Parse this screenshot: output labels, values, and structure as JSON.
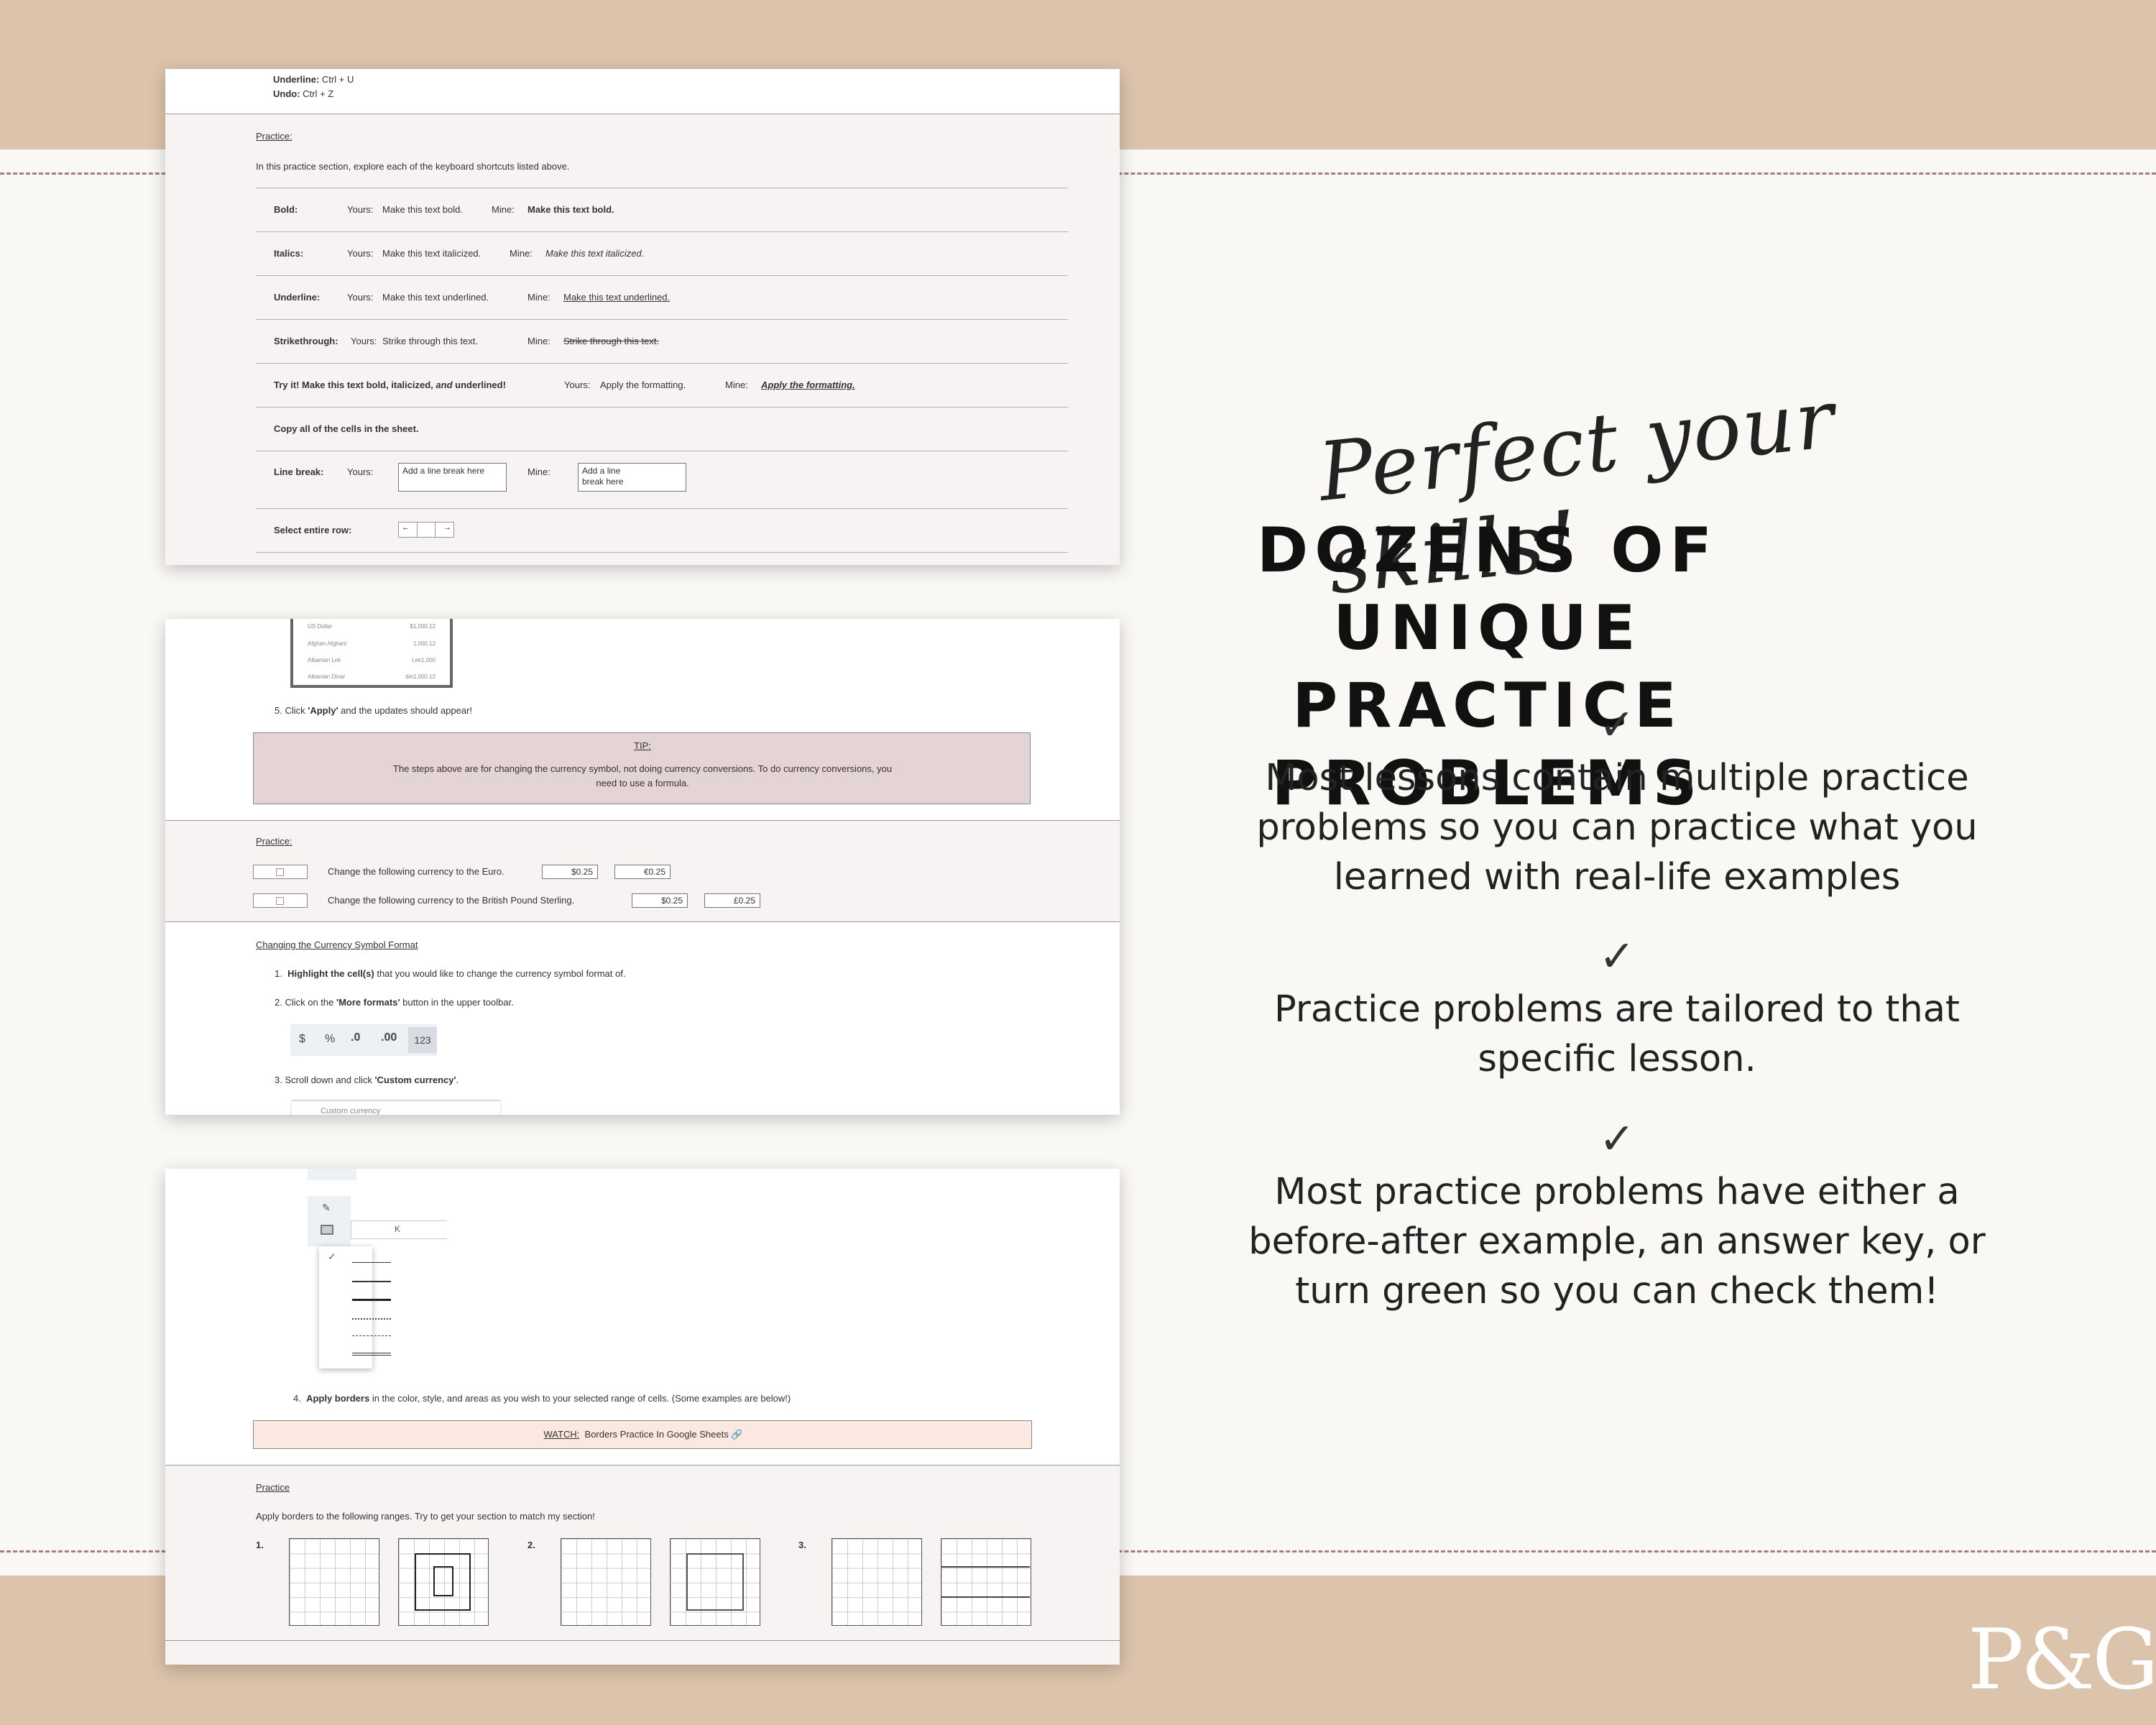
{
  "card1": {
    "underline_line_label": "Underline:",
    "underline_line_value": "Ctrl + U",
    "undo_label": "Undo:",
    "undo_value": "Ctrl + Z",
    "practice_heading": "Practice:",
    "intro": "In this practice section, explore each of the keyboard shortcuts listed above.",
    "rows": [
      {
        "label": "Bold:",
        "yours_label": "Yours:",
        "yours": "Make this text bold.",
        "mine_label": "Mine:",
        "mine": "Make this text bold."
      },
      {
        "label": "Italics:",
        "yours_label": "Yours:",
        "yours": "Make this text italicized.",
        "mine_label": "Mine:",
        "mine": "Make this text italicized."
      },
      {
        "label": "Underline:",
        "yours_label": "Yours:",
        "yours": "Make this text underlined.",
        "mine_label": "Mine:",
        "mine": "Make this text underlined."
      },
      {
        "label": "Strikethrough:",
        "yours_label": "Yours:",
        "yours": "Strike through this text.",
        "mine_label": "Mine:",
        "mine": "Strike through this text."
      }
    ],
    "tryit_a": "Try it! Make this text bold, italicized,",
    "tryit_and": "and",
    "tryit_b": "underlined!",
    "tryit_yours_label": "Yours:",
    "tryit_yours": "Apply the formatting.",
    "tryit_mine_label": "Mine:",
    "tryit_mine": "Apply the formatting.",
    "copy_all": "Copy all of the cells in the sheet.",
    "linebreak_label": "Line break:",
    "linebreak_yours_label": "Yours:",
    "linebreak_yours": "Add a line break here",
    "linebreak_mine_label": "Mine:",
    "linebreak_mine_1": "Add a line",
    "linebreak_mine_2": "break here",
    "select_row_label": "Select entire row:",
    "arrow_left": "←",
    "arrow_right": "→"
  },
  "card2": {
    "currency_rows": [
      {
        "name": "US Dollar",
        "value": "$1,000.12"
      },
      {
        "name": "Afghan Afghani",
        "value": "1,000.12"
      },
      {
        "name": "Albanian Lek",
        "value": "Lek1,000"
      },
      {
        "name": "Albanian Dinar",
        "value": "din1,000.12"
      }
    ],
    "step5_pre": "5.  Click",
    "step5_bold": "'Apply'",
    "step5_post": "and the updates should appear!",
    "tip_heading": "TIP:",
    "tip_text_1": "The steps above are for changing the currency symbol, not doing currency conversions. To do currency conversions, you",
    "tip_text_2": "need to use a formula.",
    "practice_heading": "Practice:",
    "practice_rows": [
      {
        "text": "Change the following currency to the Euro.",
        "from": "$0.25",
        "to": "€0.25"
      },
      {
        "text": "Change the following currency to the British Pound Sterling.",
        "from": "$0.25",
        "to": "£0.25"
      }
    ],
    "changing_heading": "Changing the Currency Symbol Format",
    "step1_num": "1.",
    "step1_bold": "Highlight the cell(s)",
    "step1_post": "that you would like to change the currency symbol format of.",
    "step2_pre": "2.  Click on the",
    "step2_bold": "'More formats'",
    "step2_post": "button in the upper toolbar.",
    "toolbar": [
      "$",
      "%",
      ".0",
      ".00",
      "123"
    ],
    "step3_pre": "3.  Scroll down and click",
    "step3_bold": "'Custom currency'",
    "step3_post": ".",
    "cut_text": "Custom currency"
  },
  "card3": {
    "dots": "•••••",
    "column_label": "K",
    "check": "✓",
    "step4_num": "4.",
    "step4_bold": "Apply borders",
    "step4_post": "in the color, style, and areas as you wish to your selected range of cells. (Some examples are below!)",
    "watch_label": "WATCH:",
    "watch_text": "Borders Practice In Google Sheets",
    "link_icon": "🔗",
    "practice_heading": "Practice",
    "practice_intro": "Apply borders to the following ranges. Try to get your section to match my section!",
    "nums": [
      "1.",
      "2.",
      "3."
    ]
  },
  "right": {
    "script_text": "Perfect your skills!",
    "headline_1": "DOZENS OF UNIQUE",
    "headline_2": "PRACTICE PROBLEMS",
    "check": "✓",
    "point1_l1": "Most lessons contain multiple practice",
    "point1_l2": "problems so you can practice what you",
    "point1_l3": "learned with real-life examples",
    "point2_l1": "Practice problems are tailored to that",
    "point2_l2": "specific lesson.",
    "point3_l1": "Most practice problems have either a",
    "point3_l2": "before-after example, an answer key, or",
    "point3_l3": "turn green so you can check them!"
  },
  "brand": {
    "logo": "P&G"
  },
  "colors": {
    "band": "#dcc3ac",
    "background": "#faf8f5",
    "dash": "#a87a8c",
    "tip_box": "#e5d4d6",
    "watch_box": "#fbe9e1"
  }
}
